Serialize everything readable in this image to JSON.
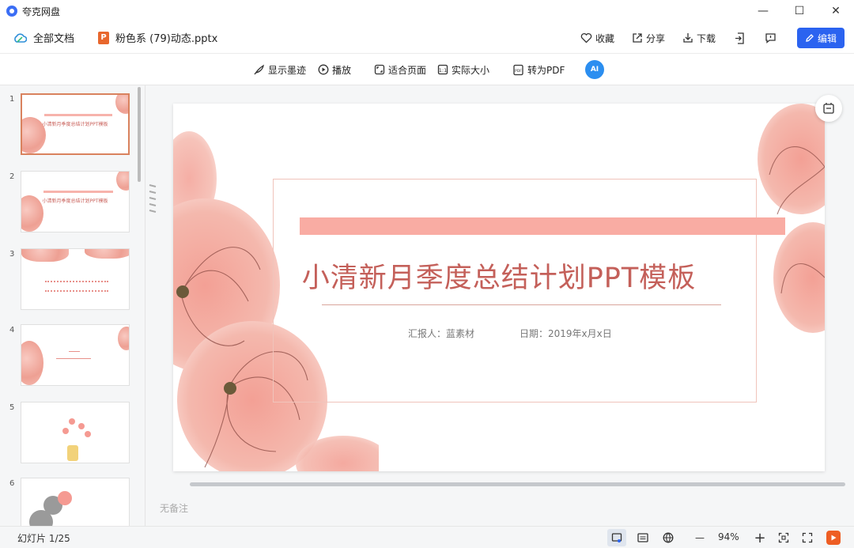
{
  "app": {
    "title": "夸克网盘"
  },
  "window": {
    "minimize": "—",
    "maximize": "☐",
    "close": "✕"
  },
  "header": {
    "all_docs": "全部文档",
    "file_icon": "P",
    "file_name": "粉色系 (79)动态.pptx",
    "favorite": "收藏",
    "share": "分享",
    "download": "下载",
    "edit": "编辑"
  },
  "toolbar": {
    "show_ink": "显示墨迹",
    "play": "播放",
    "fit_page": "适合页面",
    "actual_size": "实际大小",
    "to_pdf": "转为PDF",
    "ai": "AI"
  },
  "thumbnails": [
    {
      "num": "1"
    },
    {
      "num": "2"
    },
    {
      "num": "3"
    },
    {
      "num": "4"
    },
    {
      "num": "5"
    },
    {
      "num": "6"
    }
  ],
  "slide": {
    "title": "小清新月季度总结计划PPT模板",
    "reporter": "汇报人：蓝素材",
    "date": "日期：2019年x月x日"
  },
  "notes": {
    "placeholder": "无备注"
  },
  "status": {
    "slide_count": "幻灯片 1/25",
    "zoom": "94%",
    "zoom_out": "—",
    "zoom_in": "+"
  },
  "colors": {
    "accent": "#2b63f0",
    "title_pink": "#c4605a",
    "bar_pink": "#f9aca3",
    "play_orange": "#ee5e24"
  }
}
